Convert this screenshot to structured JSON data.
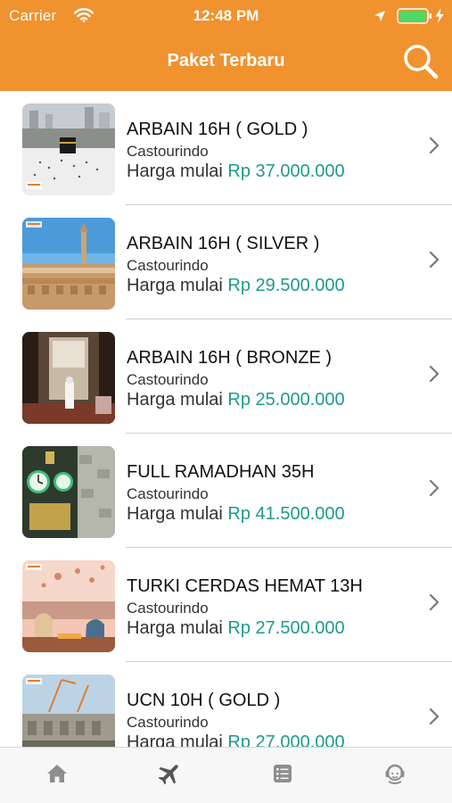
{
  "status_bar": {
    "carrier": "Carrier",
    "time": "12:48 PM",
    "icons": [
      "wifi-icon",
      "location-arrow-icon",
      "battery-icon",
      "charging-bolt-icon"
    ]
  },
  "nav": {
    "title": "Paket Terbaru",
    "search_icon": "search-icon"
  },
  "colors": {
    "header": "#F0922E",
    "price": "#1E9A8A",
    "battery": "#4CD964"
  },
  "packages": [
    {
      "title": "ARBAIN 16H ( GOLD )",
      "agent": "Castourindo",
      "price_prefix": "Harga mulai",
      "price": "Rp 37.000.000"
    },
    {
      "title": "ARBAIN 16H ( SILVER )",
      "agent": "Castourindo",
      "price_prefix": "Harga mulai",
      "price": "Rp 29.500.000"
    },
    {
      "title": "ARBAIN 16H ( BRONZE )",
      "agent": "Castourindo",
      "price_prefix": "Harga mulai",
      "price": "Rp 25.000.000"
    },
    {
      "title": "FULL RAMADHAN 35H",
      "agent": "Castourindo",
      "price_prefix": "Harga mulai",
      "price": "Rp 41.500.000"
    },
    {
      "title": "TURKI CERDAS HEMAT 13H",
      "agent": "Castourindo",
      "price_prefix": "Harga mulai",
      "price": "Rp 27.500.000"
    },
    {
      "title": "UCN 10H ( GOLD )",
      "agent": "Castourindo",
      "price_prefix": "Harga mulai",
      "price": "Rp 27.000.000"
    }
  ],
  "tabbar": {
    "tabs": [
      "home-icon",
      "airplane-icon",
      "list-icon",
      "support-agent-icon"
    ],
    "active": "airplane-icon"
  }
}
